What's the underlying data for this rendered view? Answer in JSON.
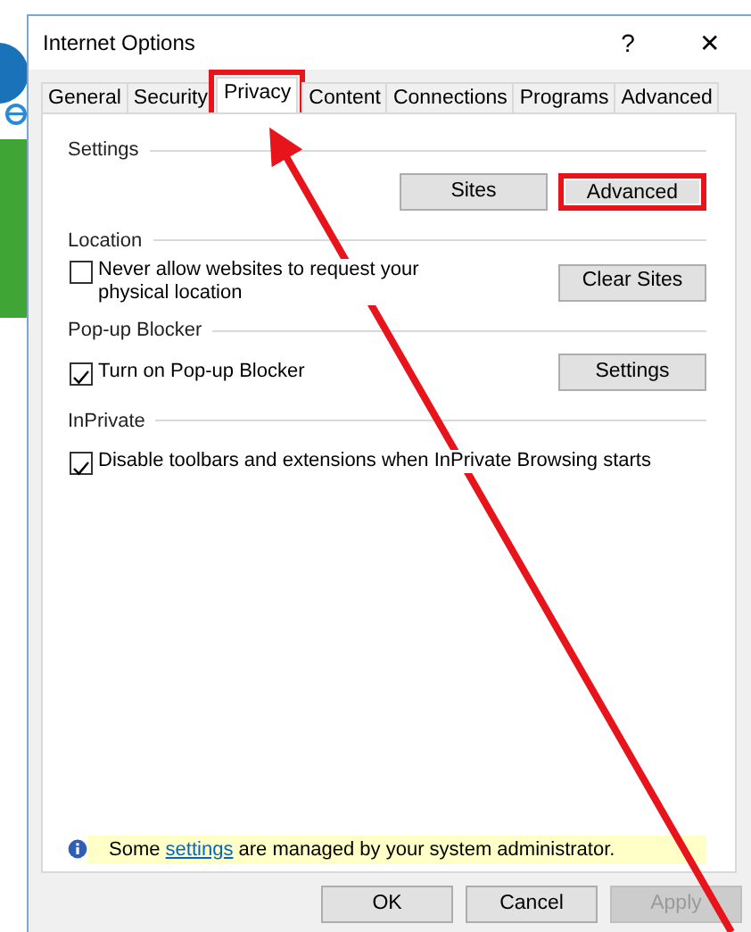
{
  "window": {
    "title": "Internet Options",
    "title_buttons": [
      "?",
      "✕"
    ]
  },
  "tabs": [
    {
      "label": "General",
      "selected": false,
      "highlighted": false
    },
    {
      "label": "Security",
      "selected": false,
      "highlighted": false
    },
    {
      "label": "Privacy",
      "selected": true,
      "highlighted": true
    },
    {
      "label": "Content",
      "selected": false,
      "highlighted": false
    },
    {
      "label": "Connections",
      "selected": false,
      "highlighted": false
    },
    {
      "label": "Programs",
      "selected": false,
      "highlighted": false
    },
    {
      "label": "Advanced",
      "selected": false,
      "highlighted": false
    }
  ],
  "sections": [
    {
      "heading": "Settings",
      "buttons": [
        {
          "label": "Sites",
          "highlighted": false
        },
        {
          "label": "Advanced",
          "highlighted": true
        }
      ]
    },
    {
      "heading": "Location",
      "checkbox": {
        "label": "Never allow websites to request your physical location",
        "checked": false
      },
      "buttons": [
        {
          "label": "Clear Sites",
          "highlighted": false
        }
      ]
    },
    {
      "heading": "Pop-up Blocker",
      "checkbox": {
        "label": "Turn on Pop-up Blocker",
        "checked": true
      },
      "buttons": [
        {
          "label": "Settings",
          "highlighted": false
        }
      ]
    },
    {
      "heading": "InPrivate",
      "checkbox": {
        "label": "Disable toolbars and extensions when InPrivate Browsing starts",
        "checked": true
      }
    }
  ],
  "info_bar": {
    "before": "Some",
    "link": "settings",
    "after": "are managed by your system administrator."
  },
  "buttons": [
    {
      "label": "OK",
      "disabled": false
    },
    {
      "label": "Cancel",
      "disabled": false
    },
    {
      "label": "Apply",
      "disabled": true
    }
  ]
}
